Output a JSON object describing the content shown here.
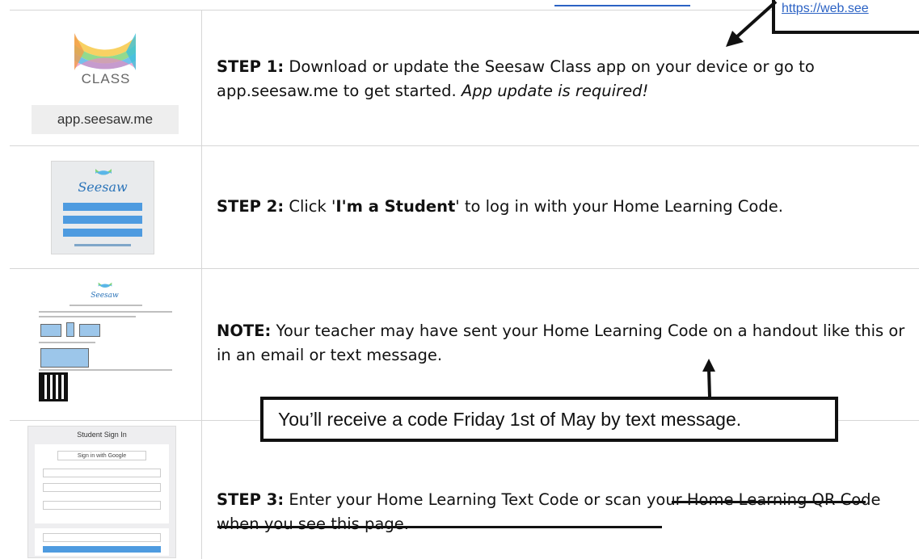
{
  "url_callout": {
    "text": "https://web.see"
  },
  "steps": [
    {
      "thumbnail": {
        "class_word": "CLASS",
        "app_url": "app.seesaw.me"
      },
      "lead": "STEP 1:",
      "text": " Download or update the Seesaw Class app on your device or go to app.seesaw.me to get started. ",
      "emphasis": "App update is required!"
    },
    {
      "thumbnail": {
        "brand": "Seesaw"
      },
      "lead": "STEP 2:",
      "text_before": " Click '",
      "bold": "I'm a Student",
      "text_after": "' to log in with your Home Learning Code."
    },
    {
      "thumbnail": {
        "brand": "Seesaw"
      },
      "lead": "NOTE:",
      "text": " Your teacher may have sent your Home Learning Code on a handout like this or in an email or text message."
    },
    {
      "thumbnail": {
        "header": "Student Sign In",
        "google_button": "Sign in with Google"
      },
      "lead": "STEP 3:",
      "text": " Enter your Home Learning Text Code ",
      "struck": "or scan your Home Learning QR Code when you see this page."
    }
  ],
  "code_callout": {
    "text": "You’ll receive a code Friday 1st of May by text message."
  }
}
